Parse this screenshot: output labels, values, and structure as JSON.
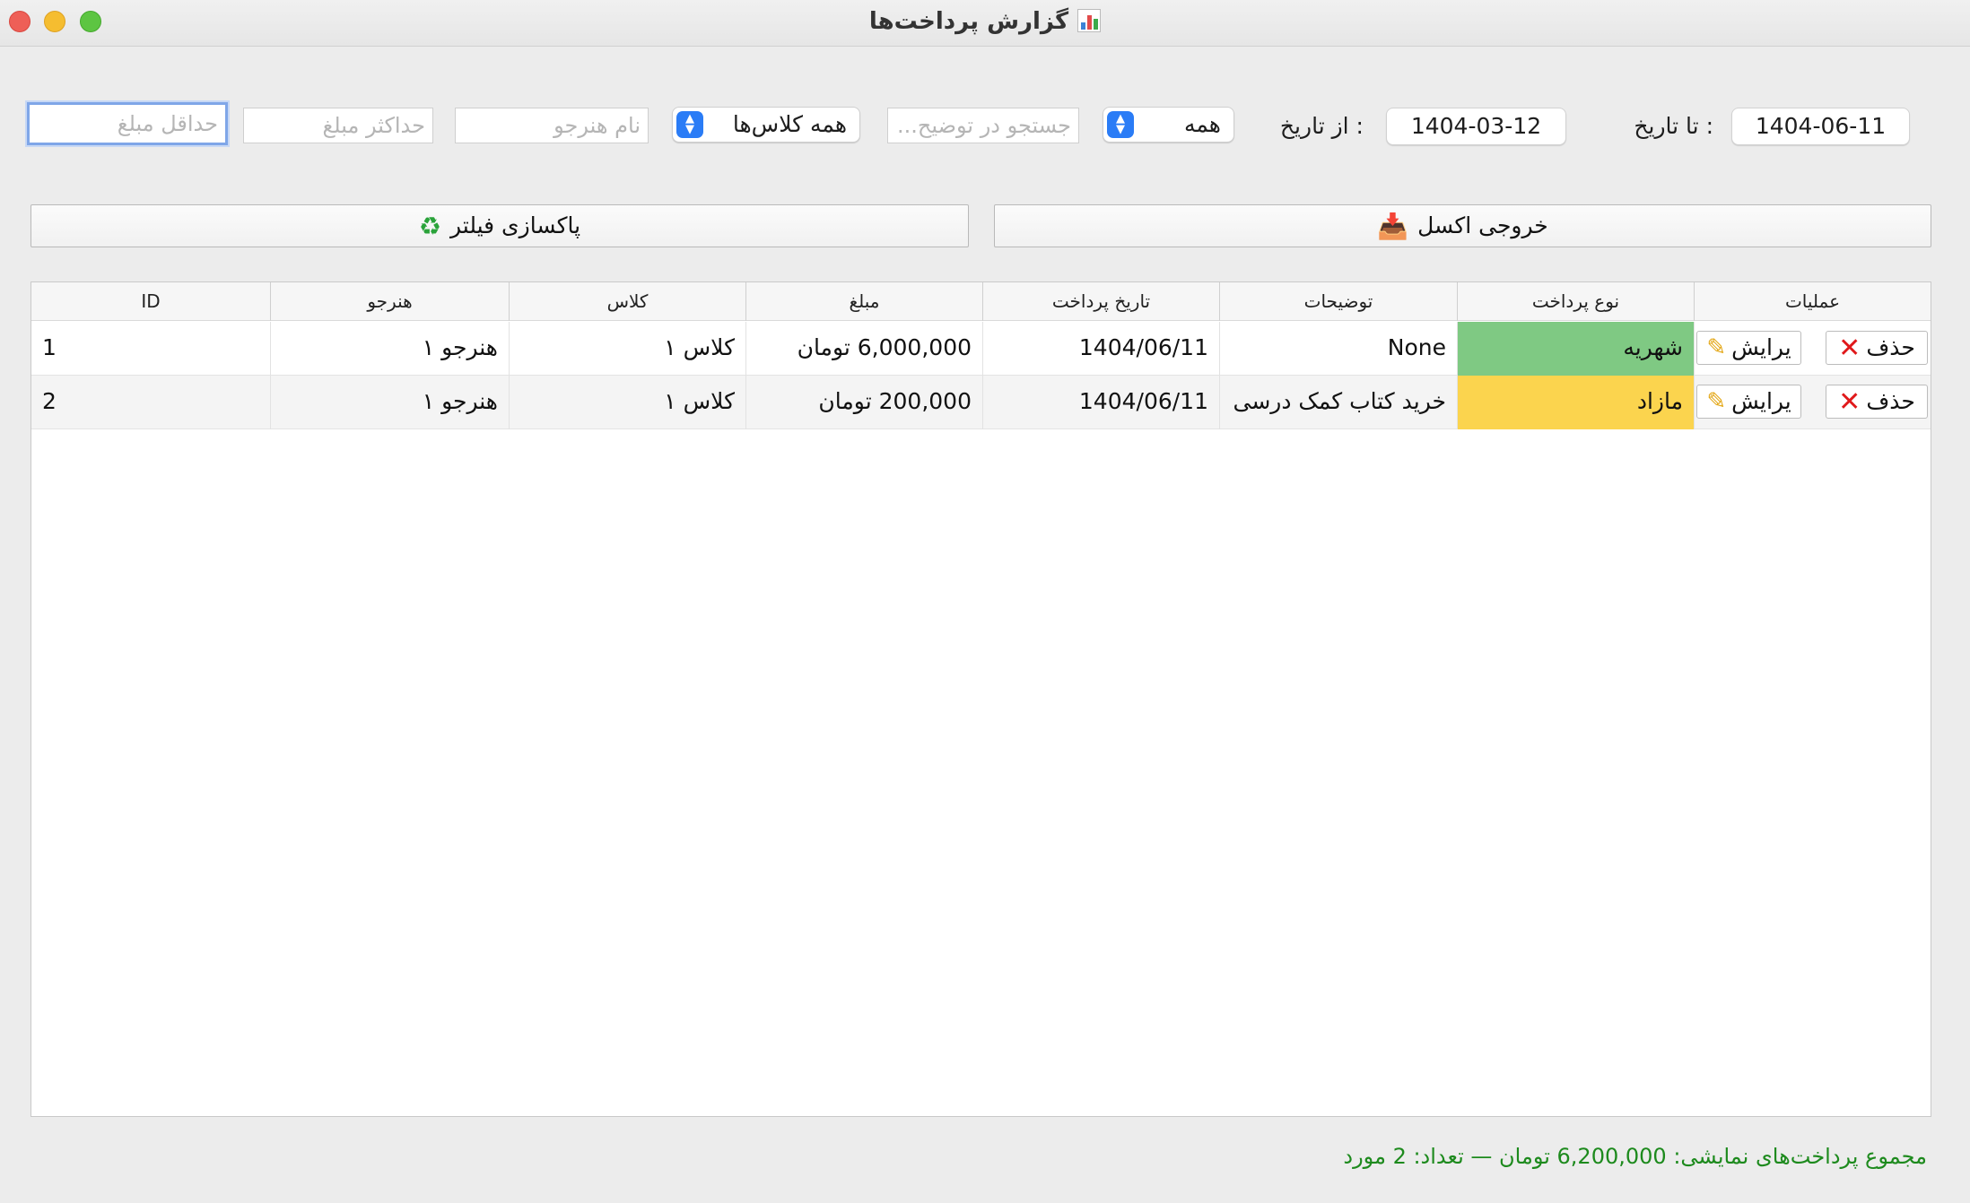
{
  "window": {
    "title": "گزارش پرداخت‌ها",
    "title_icon": "bar-chart-icon"
  },
  "filters": {
    "min_amount_placeholder": "حداقل مبلغ",
    "max_amount_placeholder": "حداکثر مبلغ",
    "student_name_placeholder": "نام هنرجو",
    "class_select": "همه کلاس‌ها",
    "description_search_placeholder": "جستجو در توضیح...",
    "type_select": "همه",
    "from_date_label": ": از تاریخ",
    "from_date": "1404-03-12",
    "to_date_label": ": تا تاریخ",
    "to_date": "1404-06-11"
  },
  "actions": {
    "reset_label": "پاکسازی فیلتر",
    "reset_icon": "recycle-icon",
    "export_label": "خروجی اکسل",
    "export_icon": "inbox-tray-icon"
  },
  "table": {
    "headers": [
      "ID",
      "هنرجو",
      "کلاس",
      "مبلغ",
      "تاریخ پرداخت",
      "توضیحات",
      "نوع پرداخت",
      "عملیات"
    ],
    "rows": [
      {
        "id": "1",
        "student": "هنرجو ۱",
        "class": "کلاس ۱",
        "amount": "6,000,000 تومان",
        "date": "1404/06/11",
        "description": "None",
        "type": "شهریه",
        "type_color": "#7fc983"
      },
      {
        "id": "2",
        "student": "هنرجو ۱",
        "class": "کلاس ۱",
        "amount": "200,000 تومان",
        "date": "1404/06/11",
        "description": "خرید کتاب کمک درسی",
        "type": "مازاد",
        "type_color": "#fbd44e"
      }
    ],
    "edit_label": "یرایش",
    "delete_label": "حذف"
  },
  "summary": "مجموع پرداخت‌های نمایشی: 6,200,000 تومان — تعداد: 2 مورد"
}
